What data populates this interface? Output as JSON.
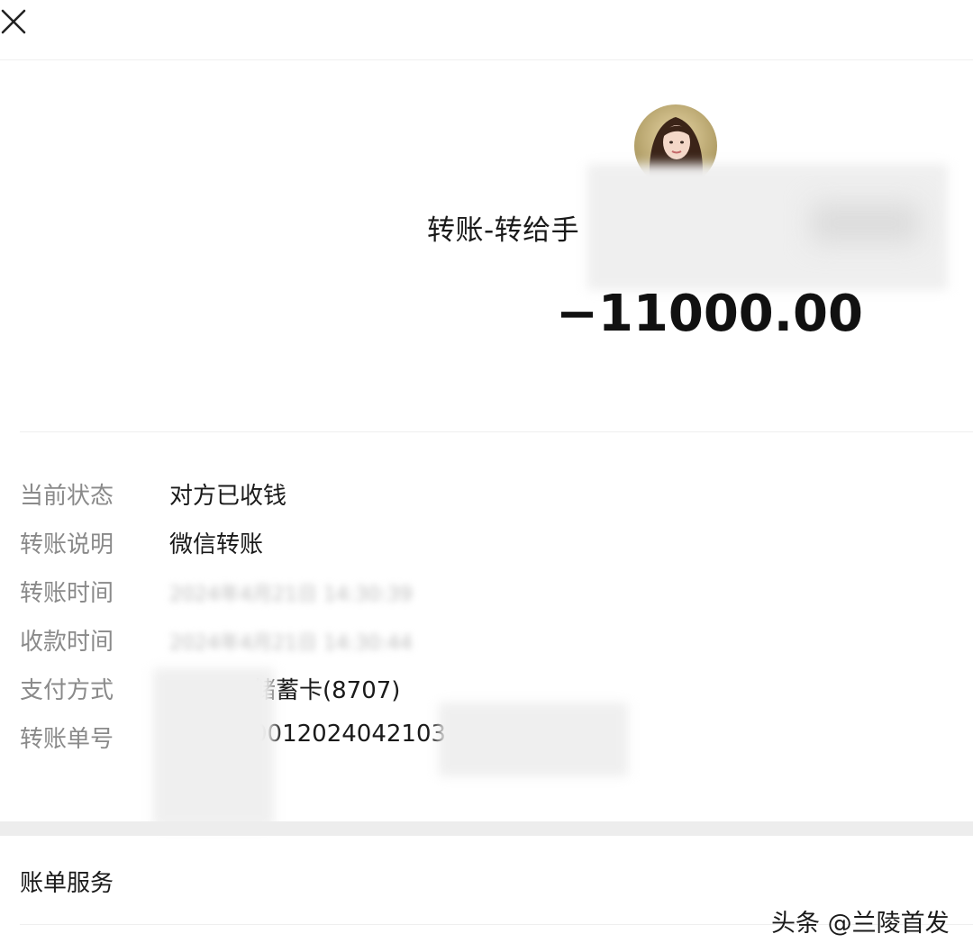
{
  "header": {
    "close_icon": "close-icon"
  },
  "transfer": {
    "title": "转账-转给手",
    "amount": "−11000.00"
  },
  "details": [
    {
      "label": "当前状态",
      "value": "对方已收钱"
    },
    {
      "label": "转账说明",
      "value": "微信转账"
    },
    {
      "label": "转账时间",
      "value": "",
      "blurred_placeholder": "2024年4月21日 14:30:39"
    },
    {
      "label": "收款时间",
      "value": "",
      "blurred_placeholder": "2024年4月21日 14:30:44"
    },
    {
      "label": "支付方式",
      "value": "储蓄卡(8707)"
    },
    {
      "label": "转账单号",
      "value": "0012024042103"
    }
  ],
  "bill_service": {
    "label": "账单服务"
  },
  "watermark": "头条 @兰陵首发",
  "colors": {
    "label_gray": "#8a8a8a",
    "text_dark": "#1a1a1a",
    "divider": "#efefef",
    "band": "#ededed"
  }
}
